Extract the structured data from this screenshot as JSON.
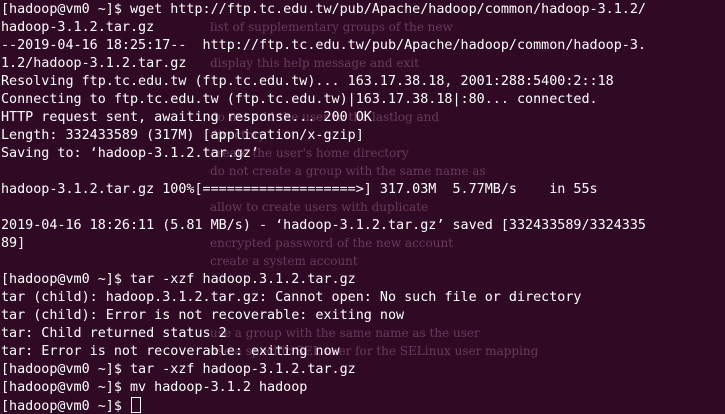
{
  "terminal": {
    "lines": [
      "[hadoop@vm0 ~]$ wget http://ftp.tc.edu.tw/pub/Apache/hadoop/common/hadoop-3.1.2/",
      "hadoop-3.1.2.tar.gz",
      "--2019-04-16 18:25:17--  http://ftp.tc.edu.tw/pub/Apache/hadoop/common/hadoop-3.",
      "1.2/hadoop-3.1.2.tar.gz",
      "Resolving ftp.tc.edu.tw (ftp.tc.edu.tw)... 163.17.38.18, 2001:288:5400:2::18",
      "Connecting to ftp.tc.edu.tw (ftp.tc.edu.tw)|163.17.38.18|:80... connected.",
      "HTTP request sent, awaiting response... 200 OK",
      "Length: 332433589 (317M) [application/x-gzip]",
      "Saving to: ‘hadoop-3.1.2.tar.gz’",
      "",
      "hadoop-3.1.2.tar.gz 100%[===================>] 317.03M  5.77MB/s    in 55s",
      "",
      "2019-04-16 18:26:11 (5.81 MB/s) - ‘hadoop-3.1.2.tar.gz’ saved [332433589/3324335",
      "89]",
      "",
      "[hadoop@vm0 ~]$ tar -xzf hadoop.3.1.2.tar.gz",
      "tar (child): hadoop.3.1.2.tar.gz: Cannot open: No such file or directory",
      "tar (child): Error is not recoverable: exiting now",
      "tar: Child returned status 2",
      "tar: Error is not recoverable: exiting now",
      "[hadoop@vm0 ~]$ tar -xzf hadoop-3.1.2.tar.gz",
      "[hadoop@vm0 ~]$ mv hadoop-3.1.2 hadoop"
    ],
    "prompt": "[hadoop@vm0 ~]$ "
  },
  "background_text": [
    "list of supplementary groups of the new",
    "display this help message and exit",
    "directory",
    "do not add the user to the lastlog and",
    "create the user's home directory",
    "do not create a group with the same name as",
    "allow to create users with duplicate",
    "encrypted password of the new account",
    "create a system account",
    "use a group with the same name as the user",
    "use a specific SEL user for the SELinux user mapping"
  ],
  "colors": {
    "background": "#300a24",
    "foreground": "#ffffff",
    "ghost_text": "#6a3a5e"
  }
}
